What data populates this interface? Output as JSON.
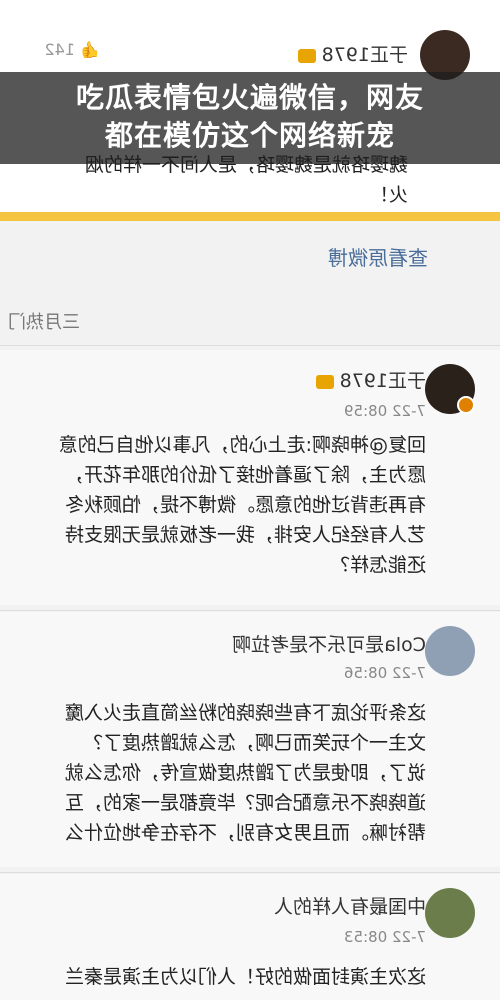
{
  "headline": {
    "line1": "吃瓜表情包火遍微信，网友",
    "line2": "都在模仿这个网络新宠"
  },
  "top_comment": {
    "author": "于正1978",
    "likes": "142",
    "body": "魏璎珞就是魏璎珞，是人间不一样的烟\n火！"
  },
  "view_original": "查看原微博",
  "hot_section": "三月热门",
  "comments": [
    {
      "author": "于正1978",
      "time": "7-22 08:59",
      "body": "回复@神晓啊:走上心的，凡事以他自己的意\n愿为主，除了逼着他接了低价的那年花开，\n有再违背过他的意愿。微博不提，怕顾秋冬\n艺人有经纪人安排，我一老板就是无限支持\n还能怎样？"
    },
    {
      "author": "Cola是可乐不是考拉啊",
      "time": "7-22 08:56",
      "body": "这条评论底下有些晓晓的粉丝简直走火入魔\n文主一个玩笑而已啊，怎么就蹭热度了？\n说了，即使是为了蹭热度做宣传，你怎么就\n道晓晓不乐意配合呢？毕竟都是一家的，互\n帮衬嘛。而且男女有别，不存在争地位什么"
    },
    {
      "author": "中国最有人样的人",
      "time": "7-22 08:53",
      "body": "这次主演封面做的好！人们以为主演是秦兰"
    }
  ]
}
